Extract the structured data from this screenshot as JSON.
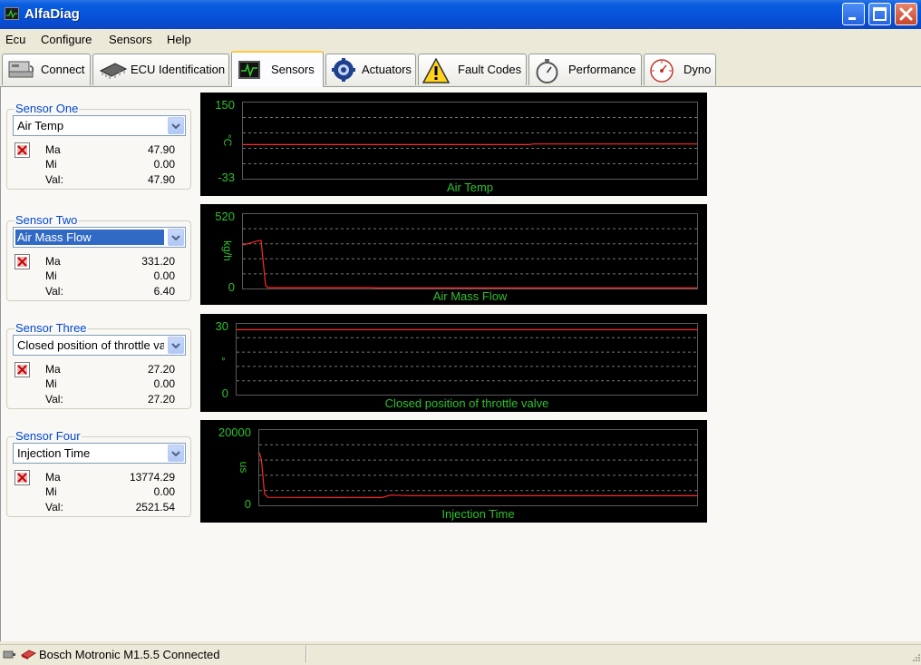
{
  "window": {
    "title": "AlfaDiag"
  },
  "menu": [
    "Ecu",
    "Configure",
    "Sensors",
    "Help"
  ],
  "tabs": [
    {
      "label": "Connect",
      "icon": "connect-icon"
    },
    {
      "label": "ECU Identification",
      "icon": "chip-icon"
    },
    {
      "label": "Sensors",
      "icon": "oscilloscope-icon",
      "active": true
    },
    {
      "label": "Actuators",
      "icon": "gear-icon"
    },
    {
      "label": "Fault Codes",
      "icon": "warning-icon"
    },
    {
      "label": "Performance",
      "icon": "stopwatch-icon"
    },
    {
      "label": "Dyno",
      "icon": "gauge-icon"
    }
  ],
  "sensors": [
    {
      "group": "Sensor One",
      "selected": "Air Temp",
      "max_label": "Ma",
      "min_label": "Mi",
      "val_label": "Val:",
      "max": "47.90",
      "min": "0.00",
      "val": "47.90"
    },
    {
      "group": "Sensor Two",
      "selected": "Air Mass Flow",
      "max_label": "Ma",
      "min_label": "Mi",
      "val_label": "Val:",
      "max": "331.20",
      "min": "0.00",
      "val": "6.40"
    },
    {
      "group": "Sensor Three",
      "selected": "Closed position of throttle va",
      "max_label": "Ma",
      "min_label": "Mi",
      "val_label": "Val:",
      "max": "27.20",
      "min": "0.00",
      "val": "27.20"
    },
    {
      "group": "Sensor Four",
      "selected": "Injection Time",
      "max_label": "Ma",
      "min_label": "Mi",
      "val_label": "Val:",
      "max": "13774.29",
      "min": "0.00",
      "val": "2521.54"
    }
  ],
  "charts": [
    {
      "title": "Air Temp",
      "unit": "°C",
      "ymax_label": "150",
      "ymin_label": "-33",
      "ymin": -33,
      "ymax": 150,
      "line_color": "#ff2a2a",
      "text_color": "#2ec02e",
      "points": [
        [
          0,
          47.9
        ],
        [
          0.63,
          47.9
        ],
        [
          0.64,
          49.5
        ],
        [
          1,
          49.5
        ]
      ]
    },
    {
      "title": "Air Mass Flow",
      "unit": "kg/h",
      "ymax_label": "520",
      "ymin_label": "0",
      "ymin": 0,
      "ymax": 520,
      "line_color": "#ff2a2a",
      "text_color": "#2ec02e",
      "points": [
        [
          0,
          300
        ],
        [
          0.035,
          331
        ],
        [
          0.04,
          331
        ],
        [
          0.05,
          20
        ],
        [
          0.055,
          6
        ],
        [
          0.28,
          6
        ],
        [
          0.3,
          4
        ],
        [
          1,
          4
        ]
      ]
    },
    {
      "title": "Closed position of throttle valve",
      "unit": "°",
      "ymax_label": "30",
      "ymin_label": "0",
      "ymin": 0,
      "ymax": 30,
      "line_color": "#ff2a2a",
      "text_color": "#2ec02e",
      "points": [
        [
          0,
          27.2
        ],
        [
          1,
          27.2
        ]
      ]
    },
    {
      "title": "Injection Time",
      "unit": "us",
      "ymax_label": "20000",
      "ymin_label": "0",
      "ymin": 0,
      "ymax": 20000,
      "line_color": "#ff2a2a",
      "text_color": "#2ec02e",
      "points": [
        [
          0,
          13774
        ],
        [
          0.005,
          12000
        ],
        [
          0.012,
          3000
        ],
        [
          0.02,
          2100
        ],
        [
          0.28,
          2050
        ],
        [
          0.3,
          2700
        ],
        [
          0.34,
          2550
        ],
        [
          1,
          2520
        ]
      ]
    }
  ],
  "status": {
    "text": "Bosch Motronic M1.5.5 Connected"
  }
}
